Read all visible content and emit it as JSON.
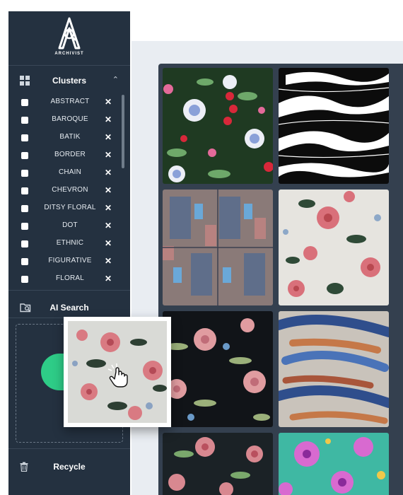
{
  "app": {
    "name": "ARCHIVIST"
  },
  "sidebar": {
    "clusters_section": {
      "title": "Clusters",
      "icon": "grid-icon",
      "collapsed": false
    },
    "clusters": [
      {
        "label": "ABSTRACT",
        "checked": false
      },
      {
        "label": "BAROQUE",
        "checked": false
      },
      {
        "label": "BATIK",
        "checked": false
      },
      {
        "label": "BORDER",
        "checked": false
      },
      {
        "label": "CHAIN",
        "checked": false
      },
      {
        "label": "CHEVRON",
        "checked": false
      },
      {
        "label": "DITSY FLORAL",
        "checked": false
      },
      {
        "label": "DOT",
        "checked": false
      },
      {
        "label": "ETHNIC",
        "checked": false
      },
      {
        "label": "FIGURATIVE",
        "checked": false
      },
      {
        "label": "FLORAL",
        "checked": false
      }
    ],
    "ai_search": {
      "title": "AI Search",
      "icon": "image-search-icon"
    },
    "recycle": {
      "title": "Recycle",
      "icon": "trash-icon"
    }
  },
  "colors": {
    "sidebar_bg": "#243140",
    "grid_bg": "#34404f",
    "accent_green": "#2ecc87"
  },
  "gallery": {
    "tiles": [
      {
        "pattern": "floral-dark-green"
      },
      {
        "pattern": "black-white-abstract"
      },
      {
        "pattern": "geometric-blocks"
      },
      {
        "pattern": "floral-light-pink"
      },
      {
        "pattern": "floral-black-dahlia"
      },
      {
        "pattern": "brushstroke-blue-orange"
      },
      {
        "pattern": "floral-dark-pink"
      },
      {
        "pattern": "floral-teal-magenta"
      }
    ]
  }
}
